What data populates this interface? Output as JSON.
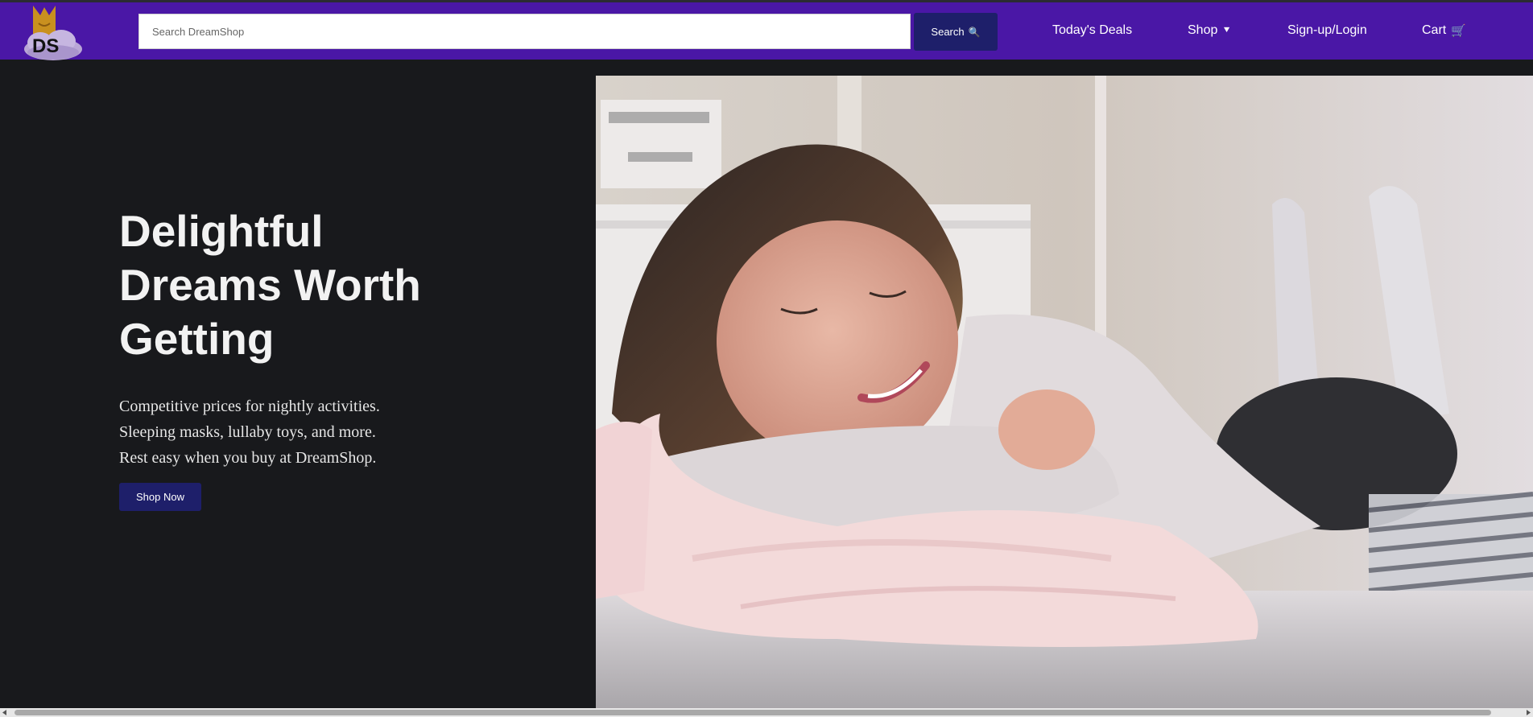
{
  "header": {
    "logo_text": "DS",
    "search": {
      "placeholder": "Search DreamShop",
      "value": ""
    },
    "search_button_label": "Search",
    "search_button_icon": "🔍",
    "nav": {
      "deals": "Today's Deals",
      "shop": "Shop",
      "shop_caret": "⯆",
      "login": "Sign-up/Login",
      "cart": "Cart",
      "cart_icon": "🛒"
    }
  },
  "hero": {
    "title_lines": [
      "Delightful",
      "Dreams Worth",
      "Getting"
    ],
    "text_lines": [
      "Competitive prices for nightly activities.",
      "Sleeping masks, lullaby toys, and more.",
      "Rest easy when you buy at DreamShop."
    ],
    "cta_label": "Shop Now"
  },
  "colors": {
    "header_bg": "#4a17a6",
    "button_bg": "#1e1f6a",
    "page_bg": "#18191c",
    "logo_crown": "#c9901f",
    "logo_cloud": "#b9a6d6"
  }
}
